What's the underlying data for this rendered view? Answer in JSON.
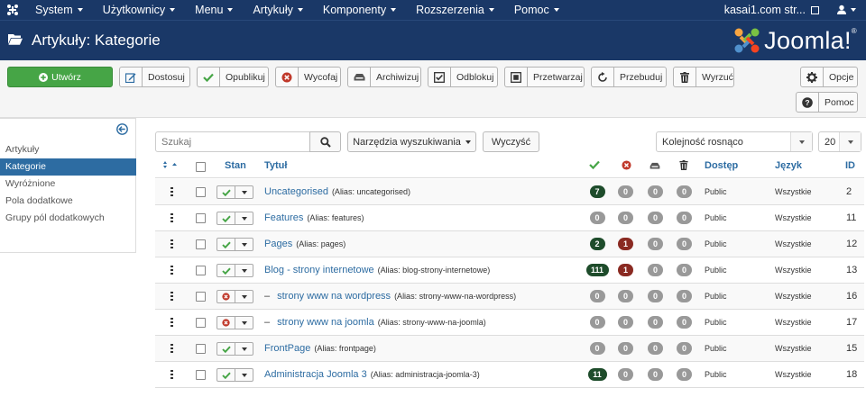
{
  "topnav": {
    "menu": [
      "System",
      "Użytkownicy",
      "Menu",
      "Artykuły",
      "Komponenty",
      "Rozszerzenia",
      "Pomoc"
    ],
    "site_link": "kasai1.com str...",
    "joomla_icon": "joomla-icon",
    "user_icon": "user-icon"
  },
  "header": {
    "title": "Artykuły: Kategorie",
    "logo_text": "Joomla!",
    "logo_mark": "®"
  },
  "toolbar": {
    "create": "Utwórz",
    "edit": "Dostosuj",
    "publish": "Opublikuj",
    "unpublish": "Wycofaj",
    "archive": "Archiwizuj",
    "checkin": "Odblokuj",
    "batch": "Przetwarzaj",
    "rebuild": "Przebuduj",
    "trash": "Wyrzuć",
    "options": "Opcje",
    "help": "Pomoc"
  },
  "sidebar": {
    "items": [
      "Artykuły",
      "Kategorie",
      "Wyróżnione",
      "Pola dodatkowe",
      "Grupy pól dodatkowych"
    ],
    "active_index": 1
  },
  "filters": {
    "search_placeholder": "Szukaj",
    "search_tools": "Narzędzia wyszukiwania",
    "clear": "Wyczyść",
    "ordering": "Kolejność rosnąco",
    "limit": "20"
  },
  "table": {
    "headers": {
      "status": "Stan",
      "title": "Tytuł",
      "access": "Dostęp",
      "language": "Język",
      "id": "ID"
    },
    "rows": [
      {
        "title": "Uncategorised",
        "alias": "(Alias: uncategorised)",
        "indent": false,
        "published": true,
        "counts": [
          "7",
          "0",
          "0",
          "0"
        ],
        "access": "Public",
        "language": "Wszystkie",
        "id": "2"
      },
      {
        "title": "Features",
        "alias": "(Alias: features)",
        "indent": false,
        "published": true,
        "counts": [
          "0",
          "0",
          "0",
          "0"
        ],
        "access": "Public",
        "language": "Wszystkie",
        "id": "11"
      },
      {
        "title": "Pages",
        "alias": "(Alias: pages)",
        "indent": false,
        "published": true,
        "counts": [
          "2",
          "1",
          "0",
          "0"
        ],
        "access": "Public",
        "language": "Wszystkie",
        "id": "12"
      },
      {
        "title": "Blog - strony internetowe",
        "alias": "(Alias: blog-strony-internetowe)",
        "indent": false,
        "published": true,
        "counts": [
          "111",
          "1",
          "0",
          "0"
        ],
        "access": "Public",
        "language": "Wszystkie",
        "id": "13"
      },
      {
        "title": "strony www na wordpress",
        "alias": "(Alias: strony-www-na-wordpress)",
        "indent": true,
        "published": false,
        "counts": [
          "0",
          "0",
          "0",
          "0"
        ],
        "access": "Public",
        "language": "Wszystkie",
        "id": "16"
      },
      {
        "title": "strony www na joomla",
        "alias": "(Alias: strony-www-na-joomla)",
        "indent": true,
        "published": false,
        "counts": [
          "0",
          "0",
          "0",
          "0"
        ],
        "access": "Public",
        "language": "Wszystkie",
        "id": "17"
      },
      {
        "title": "FrontPage",
        "alias": "(Alias: frontpage)",
        "indent": false,
        "published": true,
        "counts": [
          "0",
          "0",
          "0",
          "0"
        ],
        "access": "Public",
        "language": "Wszystkie",
        "id": "15"
      },
      {
        "title": "Administracja Joomla 3",
        "alias": "(Alias: administracja-joomla-3)",
        "indent": false,
        "published": true,
        "counts": [
          "11",
          "0",
          "0",
          "0"
        ],
        "access": "Public",
        "language": "Wszystkie",
        "id": "18"
      }
    ]
  },
  "colors": {
    "nav": "#1a3867",
    "accent": "#2d6ca2",
    "create_button": "#46a546",
    "badge_published": "#1e4c2b",
    "badge_unpublished": "#8a2a22",
    "badge_zero": "#999999"
  }
}
